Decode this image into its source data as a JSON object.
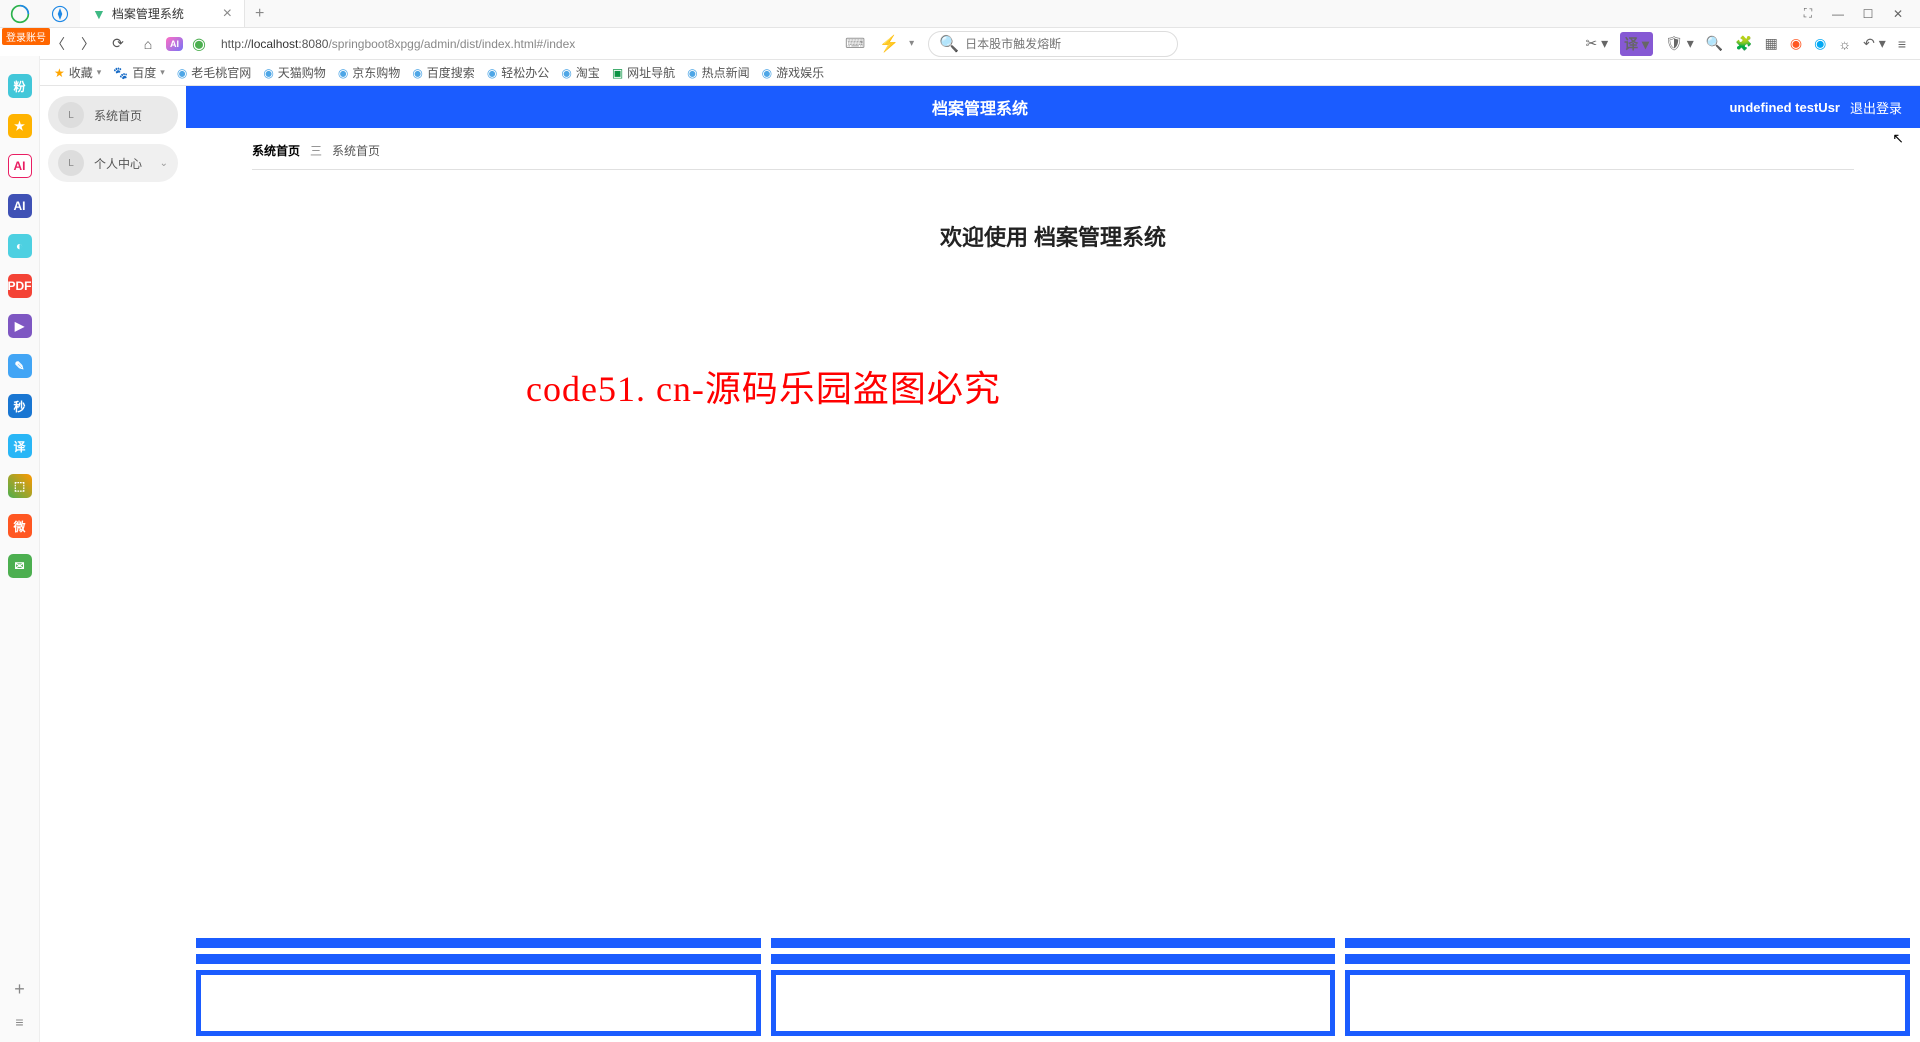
{
  "browser": {
    "tab_title": "档案管理系统",
    "login_badge": "登录账号",
    "url_prefix": "http://",
    "url_host": "localhost",
    "url_port": ":8080",
    "url_path": "/springboot8xpgg/admin/dist/index.html#/index",
    "search_placeholder": "日本股市触发熔断",
    "win": {
      "pip": "⛶",
      "min": "—",
      "max": "☐",
      "close": "✕"
    }
  },
  "bookmarks": {
    "fav": "收藏",
    "items": [
      "百度",
      "老毛桃官网",
      "天猫购物",
      "京东购物",
      "百度搜索",
      "轻松办公",
      "淘宝",
      "网址导航",
      "热点新闻",
      "游戏娱乐"
    ]
  },
  "app": {
    "nav": {
      "home": "系统首页",
      "personal": "个人中心"
    },
    "header_title": "档案管理系统",
    "user": "undefined testUsr",
    "logout": "退出登录",
    "breadcrumb": {
      "root": "系统首页",
      "current": "系统首页"
    },
    "welcome": "欢迎使用 档案管理系统",
    "watermark": "code51. cn-源码乐园盗图必究"
  }
}
